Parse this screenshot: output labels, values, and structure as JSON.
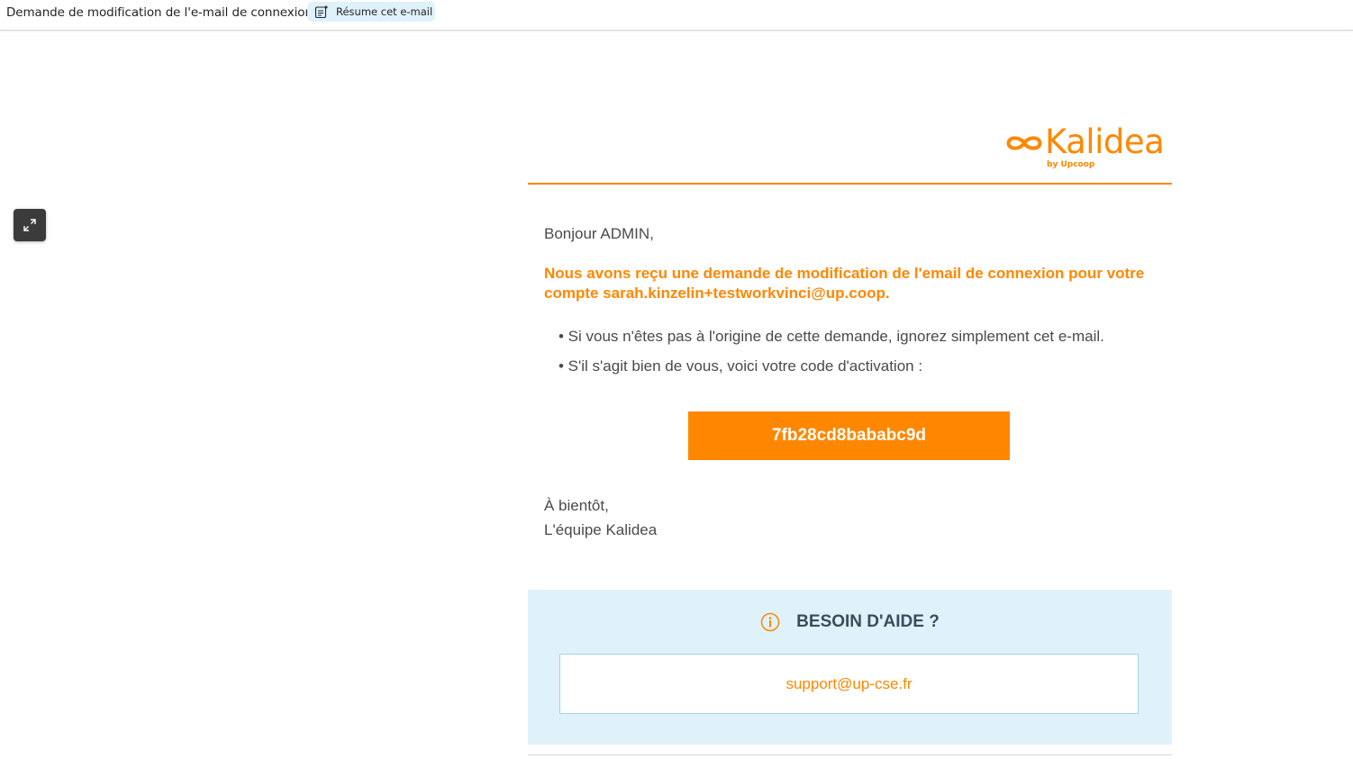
{
  "header": {
    "subject": "Demande de modification de l'e-mail de connexion",
    "summary_button": "Résume cet e-mail"
  },
  "email": {
    "logo": {
      "brand": "Kalidea",
      "tagline": "by Upcoop",
      "color": "#ff8700"
    },
    "greeting": "Bonjour ADMIN,",
    "intro": "Nous avons reçu une demande de modification de l'email de connexion pour votre compte sarah.kinzelin+testworkvinci@up.coop.",
    "bullets": [
      "• Si vous n'êtes pas à l'origine de cette demande, ignorez simplement cet e-mail.",
      "• S'il s'agit bien de vous, voici votre code d'activation :"
    ],
    "activation_code": "7fb28cd8bababc9d",
    "signoff": [
      "À bientôt,",
      "L'équipe Kalidea"
    ],
    "help": {
      "title": "BESOIN D'AIDE ?",
      "support_email": "support@up-cse.fr"
    }
  },
  "icons": {
    "summary": "summary-sparkle-icon",
    "expand": "expand-icon",
    "info": "info-icon"
  },
  "colors": {
    "accent": "#ff8700",
    "help_bg": "#e0f2f9",
    "text": "#4a4a4a"
  }
}
